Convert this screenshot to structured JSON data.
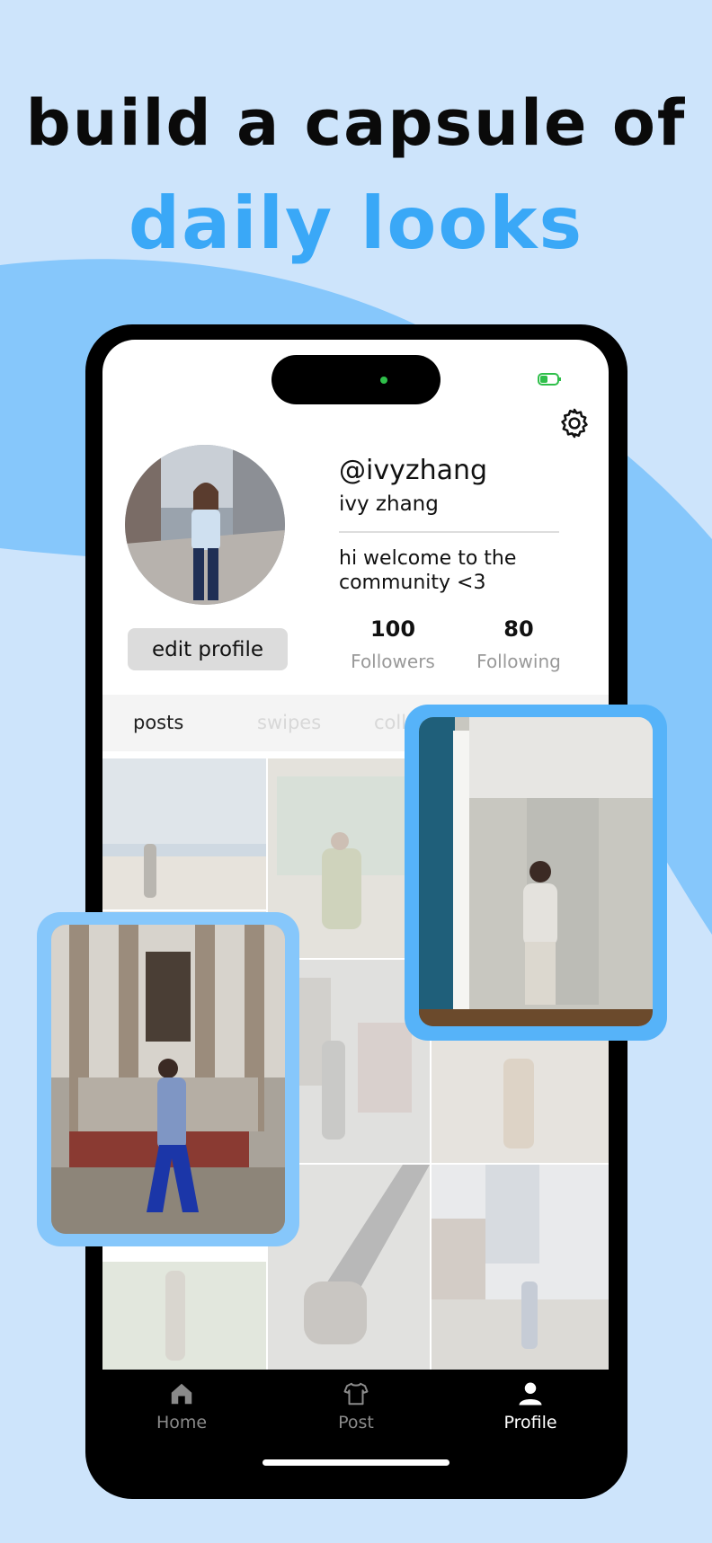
{
  "headline": {
    "line1": "build a capsule of",
    "line2": "daily looks"
  },
  "colors": {
    "background": "#cde4fb",
    "accent": "#3aa8f7",
    "wave": "#86c7fb",
    "card_frame": "#56b3f9"
  },
  "status_bar": {
    "battery_icon": "battery-charging-icon"
  },
  "profile": {
    "handle": "@ivyzhang",
    "name": "ivy zhang",
    "bio": "hi welcome to the community <3",
    "edit_button": "edit profile",
    "settings_icon": "gear-icon",
    "stats": [
      {
        "value": "100",
        "label": "Followers"
      },
      {
        "value": "80",
        "label": "Following"
      }
    ]
  },
  "tabs": [
    {
      "label": "posts",
      "active": true
    },
    {
      "label": "swipes",
      "active": false
    },
    {
      "label": "coll",
      "active": false
    }
  ],
  "nav": [
    {
      "label": "Home",
      "icon": "home-icon",
      "active": false
    },
    {
      "label": "Post",
      "icon": "shirt-icon",
      "active": false
    },
    {
      "label": "Profile",
      "icon": "person-icon",
      "active": true
    }
  ]
}
